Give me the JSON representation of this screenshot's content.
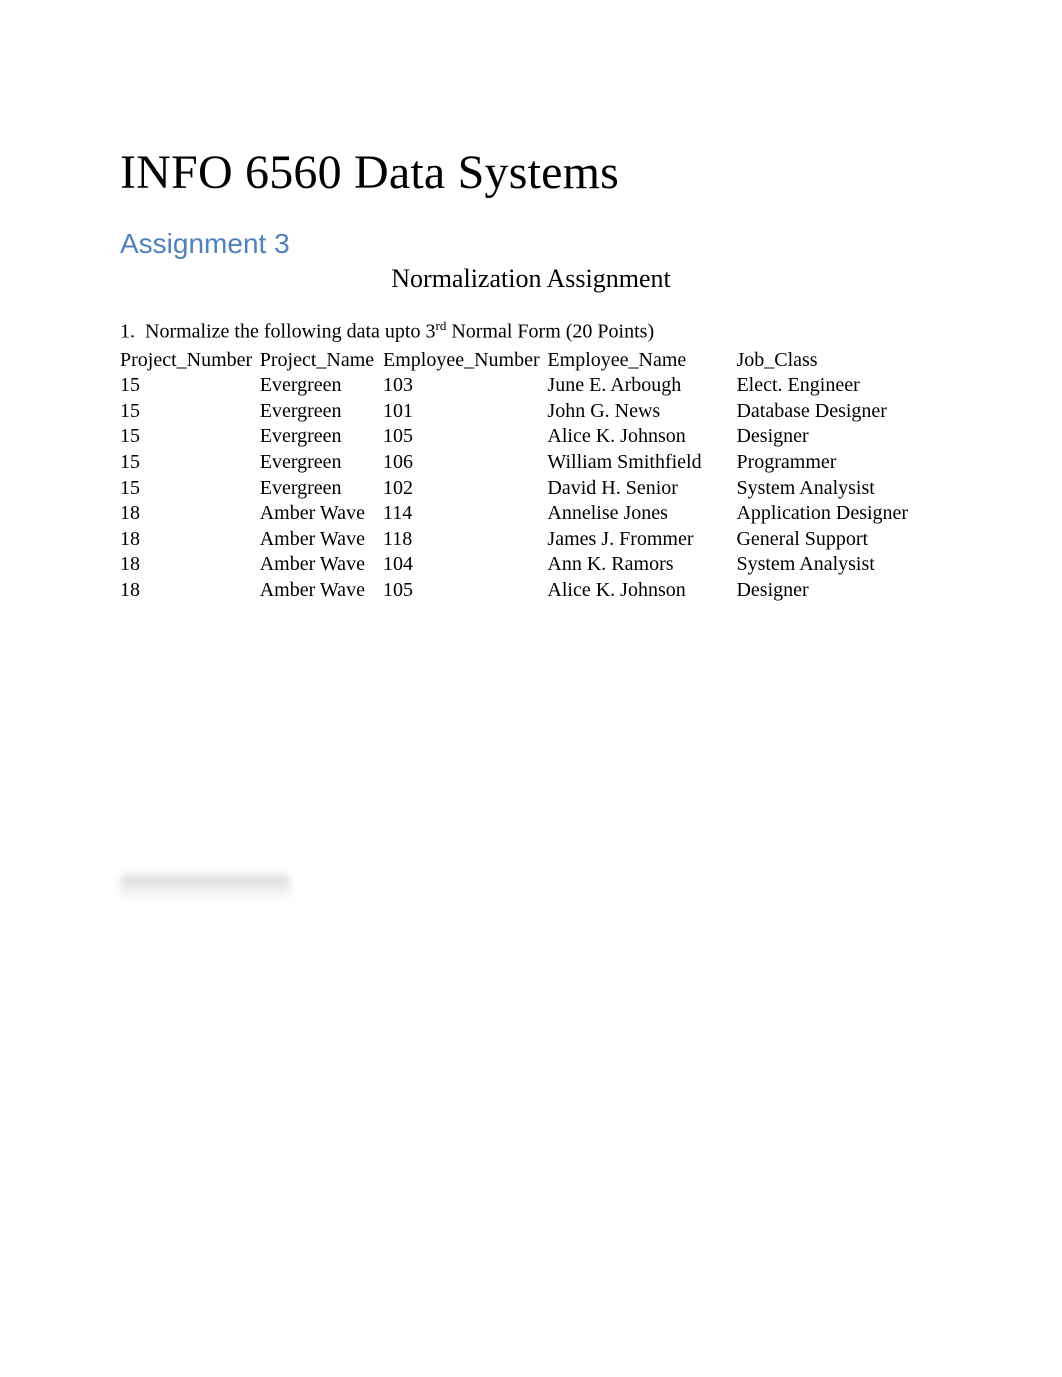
{
  "title": "INFO 6560 Data Systems",
  "subtitle": "Assignment 3",
  "section_heading": "Normalization Assignment",
  "question": {
    "number": "1.",
    "text_before": "Normalize the following data upto 3",
    "ordinal": "rd",
    "text_after": " Normal Form (20 Points)"
  },
  "table": {
    "headers": {
      "project_number": "Project_Number",
      "project_name": "Project_Name",
      "employee_number": "Employee_Number",
      "employee_name": "Employee_Name",
      "job_class": "Job_Class"
    },
    "rows": [
      {
        "project_number": "15",
        "project_name": "Evergreen",
        "employee_number": "103",
        "employee_name": "June E. Arbough",
        "job_class": "Elect. Engineer"
      },
      {
        "project_number": "15",
        "project_name": "Evergreen",
        "employee_number": "101",
        "employee_name": "John G. News",
        "job_class": "Database Designer"
      },
      {
        "project_number": "15",
        "project_name": "Evergreen",
        "employee_number": "105",
        "employee_name": "Alice K. Johnson",
        "job_class": "Designer"
      },
      {
        "project_number": "15",
        "project_name": "Evergreen",
        "employee_number": "106",
        "employee_name": "William Smithfield",
        "job_class": "Programmer"
      },
      {
        "project_number": "15",
        "project_name": "Evergreen",
        "employee_number": "102",
        "employee_name": "David H. Senior",
        "job_class": "System Analysist"
      },
      {
        "project_number": "18",
        "project_name": "Amber Wave",
        "employee_number": "114",
        "employee_name": "Annelise Jones",
        "job_class": "Application Designer"
      },
      {
        "project_number": "18",
        "project_name": "Amber Wave",
        "employee_number": "118",
        "employee_name": "James J. Frommer",
        "job_class": "General Support"
      },
      {
        "project_number": "18",
        "project_name": "Amber Wave",
        "employee_number": "104",
        "employee_name": "Ann K. Ramors",
        "job_class": "System Analysist"
      },
      {
        "project_number": "18",
        "project_name": "Amber Wave",
        "employee_number": "105",
        "employee_name": "Alice K. Johnson",
        "job_class": "Designer"
      }
    ]
  }
}
